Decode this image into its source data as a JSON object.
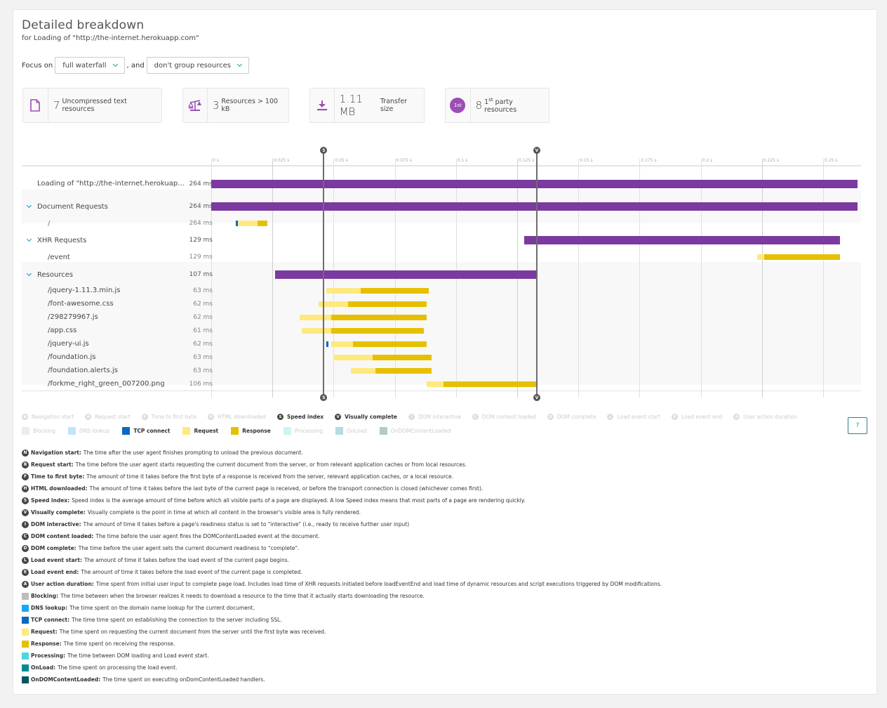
{
  "header": {
    "title": "Detailed breakdown",
    "subtitle": "for Loading of \"http://the-internet.herokuapp.com\""
  },
  "filters": {
    "focus_label": "Focus on",
    "focus_value": "full waterfall",
    "and_label": ", and",
    "group_value": "don't group resources"
  },
  "kpis": [
    {
      "icon": "document-icon",
      "value": "7",
      "label": "Uncompressed text resources"
    },
    {
      "icon": "scale-icon",
      "value": "3",
      "label": "Resources > 100 kB"
    },
    {
      "icon": "download-icon",
      "value": "1.11 MB",
      "label": "Transfer size"
    },
    {
      "icon": "first-party-icon",
      "badge": "1st",
      "value": "8",
      "label_prefix": "1",
      "label_sup": "st",
      "label": "party resources"
    }
  ],
  "colors": {
    "purple": "#7b3a9f",
    "request": "#ffe97f",
    "response": "#e6c000",
    "tcp": "#0a6abf",
    "dns": "#19a8f4",
    "blocking": "#bdbdbd",
    "processing": "#4fd5e0",
    "onload": "#008b92",
    "ondomcontentloaded": "#00545c",
    "marker": "#555555"
  },
  "chart_data": {
    "type": "waterfall",
    "x_unit": "s",
    "xlim": [
      0,
      0.264
    ],
    "ticks": [
      "0 s",
      "0.025 s",
      "0.05 s",
      "0.075 s",
      "0.1 s",
      "0.125 s",
      "0.15 s",
      "0.175 s",
      "0.2 s",
      "0.225 s",
      "0.25 s"
    ],
    "tick_values": [
      0,
      0.025,
      0.05,
      0.075,
      0.1,
      0.125,
      0.15,
      0.175,
      0.2,
      0.225,
      0.25
    ],
    "markers": [
      {
        "letter": "S",
        "name": "Speed index",
        "time_ms": 46
      },
      {
        "letter": "V",
        "name": "Visually complete",
        "time_ms": 133
      }
    ],
    "rows": [
      {
        "name": "Loading of \"http://the-internet.herokuap...",
        "duration": "264 ms",
        "kind": "action",
        "segments": [
          {
            "type": "total",
            "start": 0,
            "end": 264
          }
        ]
      },
      {
        "name": "Document Requests",
        "duration": "264 ms",
        "kind": "group",
        "segments": [
          {
            "type": "total",
            "start": 0,
            "end": 264
          }
        ]
      },
      {
        "name": "/",
        "duration": "264 ms",
        "kind": "child",
        "segments": [
          {
            "type": "tcp",
            "start": 10,
            "end": 11
          },
          {
            "type": "request",
            "start": 11,
            "end": 19
          },
          {
            "type": "response",
            "start": 19,
            "end": 23
          }
        ]
      },
      {
        "name": "XHR Requests",
        "duration": "129 ms",
        "kind": "group",
        "segments": [
          {
            "type": "total",
            "start": 128,
            "end": 257
          }
        ]
      },
      {
        "name": "/event",
        "duration": "129 ms",
        "kind": "child",
        "segments": [
          {
            "type": "request",
            "start": 223,
            "end": 226
          },
          {
            "type": "response",
            "start": 226,
            "end": 257
          }
        ]
      },
      {
        "name": "Resources",
        "duration": "107 ms",
        "kind": "group",
        "segments": [
          {
            "type": "total",
            "start": 26,
            "end": 133
          }
        ]
      },
      {
        "name": "/jquery-1.11.3.min.js",
        "duration": "63 ms",
        "kind": "child",
        "segments": [
          {
            "type": "request",
            "start": 47,
            "end": 61
          },
          {
            "type": "response",
            "start": 61,
            "end": 89
          }
        ]
      },
      {
        "name": "/font-awesome.css",
        "duration": "62 ms",
        "kind": "child",
        "segments": [
          {
            "type": "request",
            "start": 44,
            "end": 56
          },
          {
            "type": "response",
            "start": 56,
            "end": 88
          }
        ]
      },
      {
        "name": "/298279967.js",
        "duration": "62 ms",
        "kind": "child",
        "segments": [
          {
            "type": "request",
            "start": 36,
            "end": 49
          },
          {
            "type": "response",
            "start": 49,
            "end": 88
          }
        ]
      },
      {
        "name": "/app.css",
        "duration": "61 ms",
        "kind": "child",
        "segments": [
          {
            "type": "request",
            "start": 37,
            "end": 49
          },
          {
            "type": "response",
            "start": 49,
            "end": 87
          }
        ]
      },
      {
        "name": "/jquery-ui.js",
        "duration": "62 ms",
        "kind": "child",
        "segments": [
          {
            "type": "tcp",
            "start": 47,
            "end": 48
          },
          {
            "type": "request",
            "start": 49,
            "end": 58
          },
          {
            "type": "response",
            "start": 58,
            "end": 88
          }
        ]
      },
      {
        "name": "/foundation.js",
        "duration": "63 ms",
        "kind": "child",
        "segments": [
          {
            "type": "request",
            "start": 50,
            "end": 66
          },
          {
            "type": "response",
            "start": 66,
            "end": 90
          }
        ]
      },
      {
        "name": "/foundation.alerts.js",
        "duration": "63 ms",
        "kind": "child",
        "segments": [
          {
            "type": "request",
            "start": 57,
            "end": 67
          },
          {
            "type": "response",
            "start": 67,
            "end": 90
          }
        ]
      },
      {
        "name": "/forkme_right_green_007200.png",
        "duration": "106 ms",
        "kind": "child",
        "segments": [
          {
            "type": "request",
            "start": 88,
            "end": 95
          },
          {
            "type": "response",
            "start": 95,
            "end": 133
          }
        ]
      }
    ]
  },
  "legend_markers": [
    {
      "letter": "N",
      "label": "Navigation start",
      "active": false
    },
    {
      "letter": "R",
      "label": "Request start",
      "active": false
    },
    {
      "letter": "F",
      "label": "Time to first byte",
      "active": false
    },
    {
      "letter": "H",
      "label": "HTML downloaded",
      "active": false
    },
    {
      "letter": "S",
      "label": "Speed index",
      "active": true
    },
    {
      "letter": "V",
      "label": "Visually complete",
      "active": true
    },
    {
      "letter": "I",
      "label": "DOM interactive",
      "active": false
    },
    {
      "letter": "C",
      "label": "DOM content loaded",
      "active": false
    },
    {
      "letter": "D",
      "label": "DOM complete",
      "active": false
    },
    {
      "letter": "L",
      "label": "Load event start",
      "active": false
    },
    {
      "letter": "E",
      "label": "Load event end",
      "active": false
    },
    {
      "letter": "A",
      "label": "User action duration",
      "active": false
    }
  ],
  "legend_phases": [
    {
      "label": "Blocking",
      "color_active": "#bdbdbd",
      "color": "#ececec",
      "active": false
    },
    {
      "label": "DNS lookup",
      "color_active": "#19a8f4",
      "color": "#bfe5fb",
      "active": false
    },
    {
      "label": "TCP connect",
      "color": "#0a6abf",
      "active": true
    },
    {
      "label": "Request",
      "color": "#ffe97f",
      "active": true
    },
    {
      "label": "Response",
      "color": "#e6c000",
      "active": true
    },
    {
      "label": "Processing",
      "color": "#cdf3f6",
      "active": false
    },
    {
      "label": "OnLoad",
      "color": "#b5dcde",
      "active": false
    },
    {
      "label": "OnDOMContentLoaded",
      "color": "#b2c9cb",
      "active": false
    }
  ],
  "help_label": "?",
  "descriptions": [
    {
      "kind": "circle",
      "letter": "N",
      "term": "Navigation start:",
      "text": "The time after the user agent finishes prompting to unload the previous document."
    },
    {
      "kind": "circle",
      "letter": "R",
      "term": "Request start:",
      "text": "The time before the user agent starts requesting the current document from the server, or from relevant application caches or from local resources."
    },
    {
      "kind": "circle",
      "letter": "F",
      "term": "Time to first byte:",
      "text": "The amount of time it takes before the first byte of a response is received from the server, relevant application caches, or a local resource."
    },
    {
      "kind": "circle",
      "letter": "H",
      "term": "HTML downloaded:",
      "text": "The amount of time it takes before the last byte of the current page is received, or before the transport connection is closed (whichever comes first)."
    },
    {
      "kind": "circle",
      "letter": "S",
      "term": "Speed index:",
      "text": "Speed index is the average amount of time before which all visible parts of a page are displayed. A low Speed index means that most parts of a page are rendering quickly."
    },
    {
      "kind": "circle",
      "letter": "V",
      "term": "Visually complete:",
      "text": "Visually complete is the point in time at which all content in the browser's visible area is fully rendered."
    },
    {
      "kind": "circle",
      "letter": "I",
      "term": "DOM interactive:",
      "text": "The amount of time it takes before a page's readiness status is set to \"interactive\" (i.e., ready to receive further user input)"
    },
    {
      "kind": "circle",
      "letter": "C",
      "term": "DOM content loaded:",
      "text": "The time before the user agent fires the DOMContentLoaded event at the document."
    },
    {
      "kind": "circle",
      "letter": "D",
      "term": "DOM complete:",
      "text": "The time before the user agent sets the current document readiness to \"complete\"."
    },
    {
      "kind": "circle",
      "letter": "L",
      "term": "Load event start:",
      "text": "The amount of time it takes before the load event of the current page begins."
    },
    {
      "kind": "circle",
      "letter": "E",
      "term": "Load event end:",
      "text": "The amount of time it takes before the load event of the current page is completed."
    },
    {
      "kind": "circle",
      "letter": "A",
      "term": "User action duration:",
      "text": "Time spent from initial user input to complete page load. Includes load time of XHR requests initiated before loadEventEnd and load time of dynamic resources and script executions triggered by DOM modifications."
    },
    {
      "kind": "swatch",
      "color": "#bdbdbd",
      "term": "Blocking:",
      "text": "The time between when the browser realizes it needs to download a resource to the time that it actually starts downloading the resource."
    },
    {
      "kind": "swatch",
      "color": "#19a8f4",
      "term": "DNS lookup:",
      "text": "The time spent on the domain name lookup for the current document."
    },
    {
      "kind": "swatch",
      "color": "#0a6abf",
      "term": "TCP connect:",
      "text": "The time time spent on establishing the connection to the server including SSL."
    },
    {
      "kind": "swatch",
      "color": "#ffe97f",
      "term": "Request:",
      "text": "The time spent on requesting the current document from the server until the first byte was received."
    },
    {
      "kind": "swatch",
      "color": "#e6c000",
      "term": "Response:",
      "text": "The time spent on receiving the response."
    },
    {
      "kind": "swatch",
      "color": "#4fd5e0",
      "term": "Processing:",
      "text": "The time between DOM loading and Load event start."
    },
    {
      "kind": "swatch",
      "color": "#008b92",
      "term": "OnLoad:",
      "text": "The time spent on processing the load event."
    },
    {
      "kind": "swatch",
      "color": "#00545c",
      "term": "OnDOMContentLoaded:",
      "text": "The time spent on executing onDomContentLoaded handlers."
    }
  ]
}
